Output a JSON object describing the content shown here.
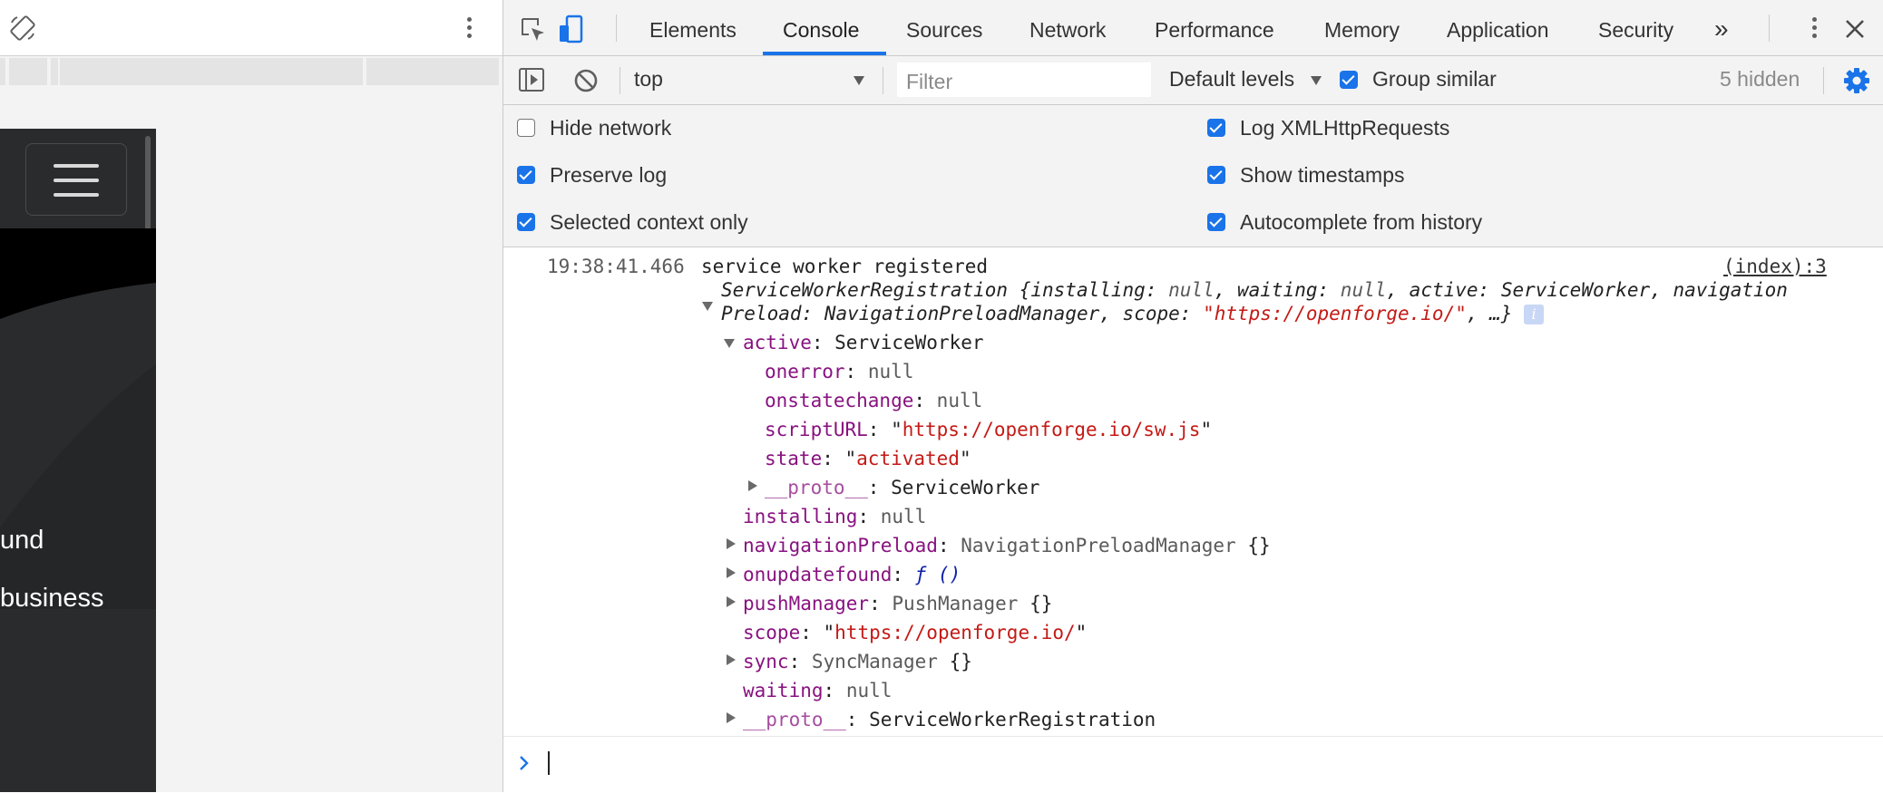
{
  "device_panel": {
    "hero_lines": [
      "und",
      "business"
    ]
  },
  "devtools": {
    "tabs": [
      "Elements",
      "Console",
      "Sources",
      "Network",
      "Performance",
      "Memory",
      "Application",
      "Security"
    ],
    "overflow_label": "»",
    "active_tab": "Console",
    "toolbar": {
      "context": "top",
      "filter_placeholder": "Filter",
      "levels": "Default levels",
      "group_similar": "Group similar",
      "hidden_count": "5 hidden"
    },
    "settings": {
      "hide_network": {
        "label": "Hide network",
        "checked": false
      },
      "preserve_log": {
        "label": "Preserve log",
        "checked": true
      },
      "selected_context_only": {
        "label": "Selected context only",
        "checked": true
      },
      "log_xhr": {
        "label": "Log XMLHttpRequests",
        "checked": true
      },
      "show_timestamps": {
        "label": "Show timestamps",
        "checked": true
      },
      "autocomplete": {
        "label": "Autocomplete from history",
        "checked": true
      }
    },
    "console": {
      "timestamp": "19:38:41.466",
      "message": "service worker registered",
      "source": "(index):3",
      "summary": {
        "class": "ServiceWorkerRegistration",
        "p1": "installing",
        "p1v": "null",
        "p2": "waiting",
        "p2v": "null",
        "p3": "active",
        "p3v": "ServiceWorker",
        "p4a": "navigation",
        "p4b": "Preload",
        "p4v": "NavigationPreloadManager",
        "p5": "scope",
        "p5v": "\"https://openforge.io/\"",
        "tail": ", …}"
      },
      "active": {
        "key": "active",
        "value": "ServiceWorker",
        "onerror": "onerror",
        "onerror_v": "null",
        "onstatechange": "onstatechange",
        "onstatechange_v": "null",
        "scripturl": "scriptURL",
        "scripturl_v": "https://openforge.io/sw.js",
        "state": "state",
        "state_v": "activated",
        "proto": "__proto__",
        "proto_v": "ServiceWorker"
      },
      "props": {
        "installing": "installing",
        "installing_v": "null",
        "navpreload": "navigationPreload",
        "navpreload_v": "NavigationPreloadManager",
        "onupdatefound": "onupdatefound",
        "onupdatefound_v": "ƒ ()",
        "pushmanager": "pushManager",
        "pushmanager_v": "PushManager",
        "scope": "scope",
        "scope_v": "https://openforge.io/",
        "sync": "sync",
        "sync_v": "SyncManager",
        "waiting": "waiting",
        "waiting_v": "null",
        "proto": "__proto__",
        "proto_v": "ServiceWorkerRegistration"
      }
    },
    "colors": {
      "accent": "#1a73e8",
      "key": "#881280",
      "string": "#c41a16"
    }
  }
}
